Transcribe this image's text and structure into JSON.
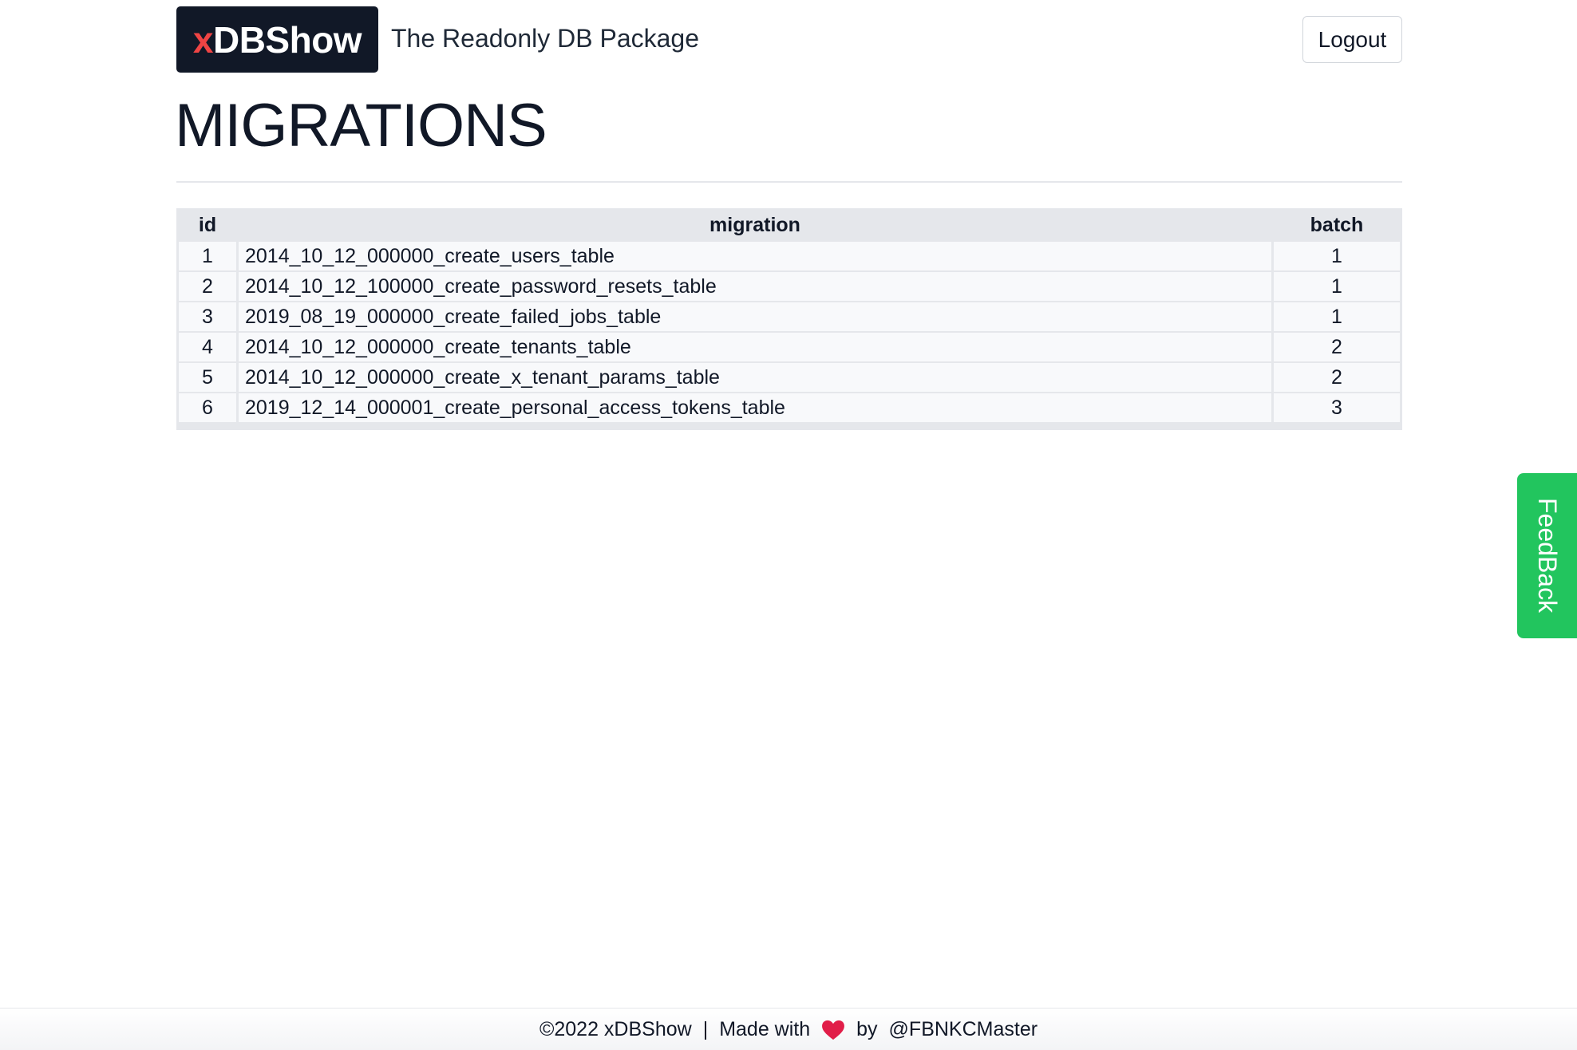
{
  "header": {
    "logo_prefix": "x",
    "logo_main": "DBShow",
    "tagline": "The Readonly DB Package",
    "logout_label": "Logout"
  },
  "page": {
    "title": "MIGRATIONS"
  },
  "table": {
    "columns": [
      "id",
      "migration",
      "batch"
    ],
    "rows": [
      {
        "id": "1",
        "migration": "2014_10_12_000000_create_users_table",
        "batch": "1"
      },
      {
        "id": "2",
        "migration": "2014_10_12_100000_create_password_resets_table",
        "batch": "1"
      },
      {
        "id": "3",
        "migration": "2019_08_19_000000_create_failed_jobs_table",
        "batch": "1"
      },
      {
        "id": "4",
        "migration": "2014_10_12_000000_create_tenants_table",
        "batch": "2"
      },
      {
        "id": "5",
        "migration": "2014_10_12_000000_create_x_tenant_params_table",
        "batch": "2"
      },
      {
        "id": "6",
        "migration": "2019_12_14_000001_create_personal_access_tokens_table",
        "batch": "3"
      }
    ]
  },
  "feedback": {
    "label": "FeedBack",
    "color": "#22c55e"
  },
  "footer": {
    "copyright": "©2022 xDBShow",
    "separator": "|",
    "made_with": "Made with",
    "heart_icon": "heart-icon",
    "by": "by",
    "author": "@FBNKCMaster"
  },
  "colors": {
    "logo_bg": "#111827",
    "logo_accent": "#ef4444",
    "heart": "#e11d48"
  }
}
